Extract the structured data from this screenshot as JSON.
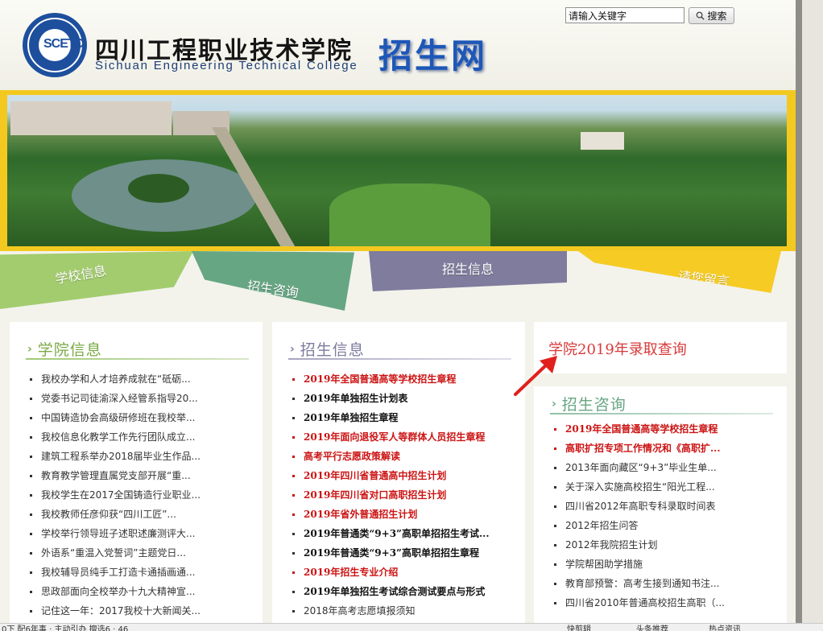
{
  "header": {
    "seal_text": "SCETC",
    "college_name_cn": "四川工程职业技术学院",
    "college_name_en": "Sichuan Engineering Technical College",
    "site_name": "招生网",
    "search": {
      "value": "请输入关键字",
      "button_label": "搜索"
    }
  },
  "nav": {
    "tabs": [
      {
        "label": "学校信息",
        "color": "#a3cc6e"
      },
      {
        "label": "招生咨询",
        "color": "#67a683"
      },
      {
        "label": "招生信息",
        "color": "#7f7c9d"
      },
      {
        "label": "请您留言",
        "color": "#f6cb24"
      }
    ]
  },
  "college_info": {
    "title": "学院信息",
    "items": [
      "我校办学和人才培养成就在“砥砺...",
      "党委书记司徒渝深入经管系指导20...",
      "中国铸造协会高级研修班在我校举...",
      "我校信息化教学工作先行团队成立...",
      "建筑工程系举办2018届毕业生作品...",
      "教育教学管理直属党支部开展“重...",
      "我校学生在2017全国铸造行业职业...",
      "我校教师任彦仰获“四川工匠”...",
      "学校举行领导班子述职述廉测评大...",
      "外语系“重温入党誓词”主题党日...",
      "我校辅导员纯手工打造卡通插画通...",
      "思政部面向全校举办十九大精神宣...",
      "记住这一年：2017我校十大新闻关..."
    ]
  },
  "admission_info": {
    "title": "招生信息",
    "items": [
      {
        "text": "2019年全国普通高等学校招生章程",
        "style": "red"
      },
      {
        "text": "2019年单独招生计划表",
        "style": "dark"
      },
      {
        "text": "2019年单独招生章程",
        "style": "dark"
      },
      {
        "text": "2019年面向退役军人等群体人员招生章程",
        "style": "red"
      },
      {
        "text": "高考平行志愿政策解读",
        "style": "red"
      },
      {
        "text": "2019年四川省普通高中招生计划",
        "style": "red"
      },
      {
        "text": "2019年四川省对口高职招生计划",
        "style": "red"
      },
      {
        "text": "2019年省外普通招生计划",
        "style": "red"
      },
      {
        "text": "2019年普通类“9+3”高职单招招生考试...",
        "style": "dark"
      },
      {
        "text": "2019年普通类“9+3”高职单招招生章程",
        "style": "dark"
      },
      {
        "text": "2019年招生专业介绍",
        "style": "red"
      },
      {
        "text": "2019年单独招生考试综合测试要点与形式",
        "style": "dark"
      },
      {
        "text": "2018年高考志愿填报须知",
        "style": "normal"
      }
    ]
  },
  "result_query": {
    "label": "学院2019年录取查询",
    "arrow_color": "#e0201c"
  },
  "admission_consult": {
    "title": "招生咨询",
    "items": [
      {
        "text": "2019年全国普通高等学校招生章程",
        "style": "red"
      },
      {
        "text": "高职扩招专项工作情况和《高职扩...",
        "style": "red"
      },
      {
        "text": "2013年面向藏区“9+3”毕业生单...",
        "style": "normal"
      },
      {
        "text": "关于深入实施高校招生“阳光工程...",
        "style": "normal"
      },
      {
        "text": "四川省2012年高职专科录取时间表",
        "style": "normal"
      },
      {
        "text": "2012年招生问答",
        "style": "normal"
      },
      {
        "text": "2012年我院招生计划",
        "style": "normal"
      },
      {
        "text": "学院帮困助学措施",
        "style": "normal"
      },
      {
        "text": "教育部预警：高考生接到通知书注...",
        "style": "normal"
      },
      {
        "text": "四川省2010年普通高校招生高职（...",
        "style": "normal"
      }
    ]
  },
  "status_bar": {
    "left_text": "0下 配6年事 · 主动引办 擅选6 · 46",
    "items": [
      "快剪辑",
      "头条推荐",
      "热点资讯"
    ]
  }
}
